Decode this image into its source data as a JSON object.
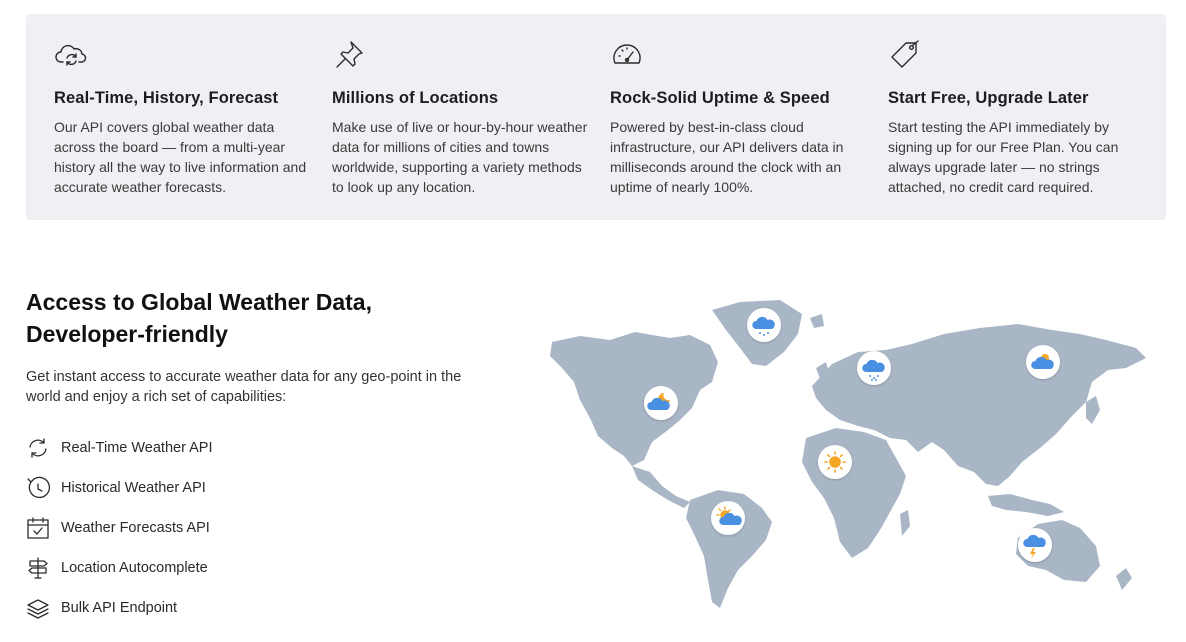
{
  "features": [
    {
      "icon": "cloud-refresh-icon",
      "title": "Real-Time, History, Forecast",
      "text": "Our API covers global weather data across the board — from a multi-year history all the way to live information and accurate weather forecasts."
    },
    {
      "icon": "pin-icon",
      "title": "Millions of Locations",
      "text": "Make use of live or hour-by-hour weather data for millions of cities and towns worldwide, supporting a variety methods to look up any location."
    },
    {
      "icon": "speedometer-icon",
      "title": "Rock-Solid Uptime & Speed",
      "text": "Powered by best-in-class cloud infrastructure, our API delivers data in milliseconds around the clock with an uptime of nearly 100%."
    },
    {
      "icon": "price-tag-icon",
      "title": "Start Free, Upgrade Later",
      "text": "Start testing the API immediately by signing up for our Free Plan. You can always upgrade later — no strings attached, no credit card required."
    }
  ],
  "section": {
    "title": "Access to Global Weather Data, Developer-friendly",
    "intro": "Get instant access to accurate weather data for any geo-point in the world and enjoy a rich set of capabilities:"
  },
  "capabilities": [
    {
      "icon": "refresh-arrows-icon",
      "label": "Real-Time Weather API"
    },
    {
      "icon": "clock-icon",
      "label": "Historical Weather API"
    },
    {
      "icon": "calendar-check-icon",
      "label": "Weather Forecasts API"
    },
    {
      "icon": "signpost-icon",
      "label": "Location Autocomplete"
    },
    {
      "icon": "layers-icon",
      "label": "Bulk API Endpoint"
    }
  ],
  "map": {
    "land_color": "#a9b6c6",
    "markers": [
      {
        "name": "map-marker-greenland",
        "icon": "snow-cloud-icon"
      },
      {
        "name": "map-marker-north-america",
        "icon": "partly-cloudy-night-icon"
      },
      {
        "name": "map-marker-europe",
        "icon": "snow-cloud-icon"
      },
      {
        "name": "map-marker-siberia",
        "icon": "partly-cloudy-icon"
      },
      {
        "name": "map-marker-africa",
        "icon": "sun-icon"
      },
      {
        "name": "map-marker-south-america",
        "icon": "partly-cloudy-icon"
      },
      {
        "name": "map-marker-australia",
        "icon": "thunderstorm-icon"
      }
    ]
  },
  "colors": {
    "panel_bg": "#eef0f3",
    "icon_stroke": "#2b2b2b",
    "cloud_blue": "#4a90e2",
    "sun_orange": "#f5a623"
  }
}
